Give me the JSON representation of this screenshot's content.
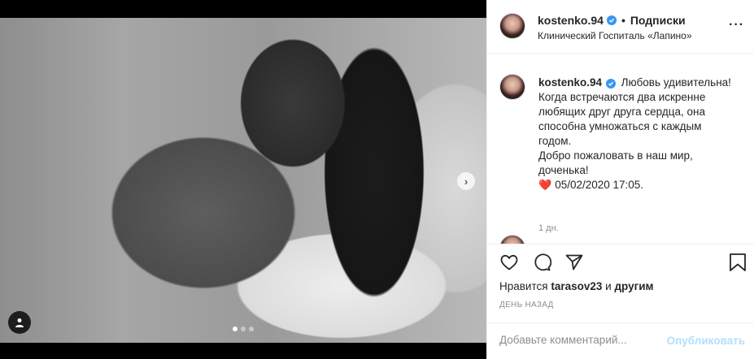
{
  "post": {
    "username": "kostenko.94",
    "separator": "•",
    "follow_label": "Подписки",
    "location": "Клинический Госпиталь «Лапино»",
    "more_label": "···"
  },
  "caption": {
    "username": "kostenko.94",
    "lines": [
      "Любовь удивительна!",
      "Когда встречаются два искренне",
      "любящих друг друга сердца, она",
      "способна умножаться с каждым",
      "годом.",
      "Добро пожаловать в наш мир,",
      "доченька!"
    ],
    "heart": "❤️",
    "date_line": "05/02/2020 17:05.",
    "time_ago": "1 дн."
  },
  "likes": {
    "prefix": "Нравится",
    "user": "tarasov23",
    "conjunction": "и",
    "others": "другим"
  },
  "date": "ДЕНЬ НАЗАД",
  "comment_box": {
    "placeholder": "Добавьте комментарий...",
    "publish_label": "Опубликовать"
  },
  "media": {
    "next_arrow": "›",
    "slides": 3,
    "active_slide": 1
  }
}
